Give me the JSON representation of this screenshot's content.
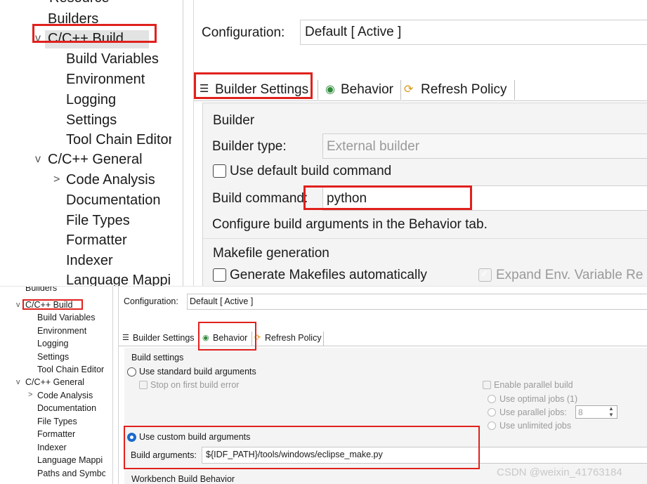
{
  "top_panel": {
    "tree": {
      "items": [
        {
          "label": "Resource",
          "chevron": ">"
        },
        {
          "label": "Builders"
        },
        {
          "label": "C/C++ Build",
          "chevron": "v"
        },
        {
          "label": "Build Variables"
        },
        {
          "label": "Environment"
        },
        {
          "label": "Logging"
        },
        {
          "label": "Settings"
        },
        {
          "label": "Tool Chain Editor"
        },
        {
          "label": "C/C++ General",
          "chevron": "v"
        },
        {
          "label": "Code Analysis",
          "chevron": ">"
        },
        {
          "label": "Documentation"
        },
        {
          "label": "File Types"
        },
        {
          "label": "Formatter"
        },
        {
          "label": "Indexer"
        },
        {
          "label": "Language Mappi"
        }
      ]
    },
    "configuration": {
      "label": "Configuration:",
      "value": "Default  [ Active ]"
    },
    "tabs": [
      {
        "label": "Builder Settings",
        "icon": "list-icon"
      },
      {
        "label": "Behavior",
        "icon": "radio-icon"
      },
      {
        "label": "Refresh Policy",
        "icon": "refresh-icon"
      }
    ],
    "builder": {
      "group_label": "Builder",
      "type_label": "Builder type:",
      "type_value": "External builder",
      "use_default_label": "Use default build command",
      "command_label": "Build command:",
      "command_value": "python",
      "hint": "Configure build arguments in the Behavior tab."
    },
    "makefile": {
      "group_label": "Makefile generation",
      "generate_label": "Generate Makefiles automatically",
      "expand_label": "Expand Env. Variable Re"
    }
  },
  "bottom_panel": {
    "tree": {
      "items": [
        {
          "label": "Builders"
        },
        {
          "label": "C/C++ Build",
          "chevron": "v"
        },
        {
          "label": "Build Variables"
        },
        {
          "label": "Environment"
        },
        {
          "label": "Logging"
        },
        {
          "label": "Settings"
        },
        {
          "label": "Tool Chain Editor"
        },
        {
          "label": "C/C++ General",
          "chevron": "v"
        },
        {
          "label": "Code Analysis",
          "chevron": ">"
        },
        {
          "label": "Documentation"
        },
        {
          "label": "File Types"
        },
        {
          "label": "Formatter"
        },
        {
          "label": "Indexer"
        },
        {
          "label": "Language Mappi"
        },
        {
          "label": "Paths and Symbo"
        }
      ]
    },
    "configuration": {
      "label": "Configuration:",
      "value": "Default  [ Active ]"
    },
    "tabs": [
      {
        "label": "Builder Settings",
        "icon": "list-icon"
      },
      {
        "label": "Behavior",
        "icon": "radio-icon"
      },
      {
        "label": "Refresh Policy",
        "icon": "refresh-icon"
      }
    ],
    "build_settings": {
      "group_label": "Build settings",
      "standard_label": "Use standard build arguments",
      "stop_label": "Stop on first build error",
      "parallel_label": "Enable parallel build",
      "optimal_label": "Use optimal jobs (1)",
      "parallel_jobs_label": "Use parallel jobs:",
      "parallel_jobs_value": "8",
      "unlimited_label": "Use unlimited jobs",
      "custom_label": "Use custom build arguments",
      "args_label": "Build arguments:",
      "args_value": "${IDF_PATH}/tools/windows/eclipse_make.py"
    },
    "workbench_label": "Workbench Build Behavior"
  },
  "watermark": "CSDN @weixin_41763184",
  "colors": {
    "annotation": "#e0211d",
    "radio_on": "#1b6ac9"
  }
}
